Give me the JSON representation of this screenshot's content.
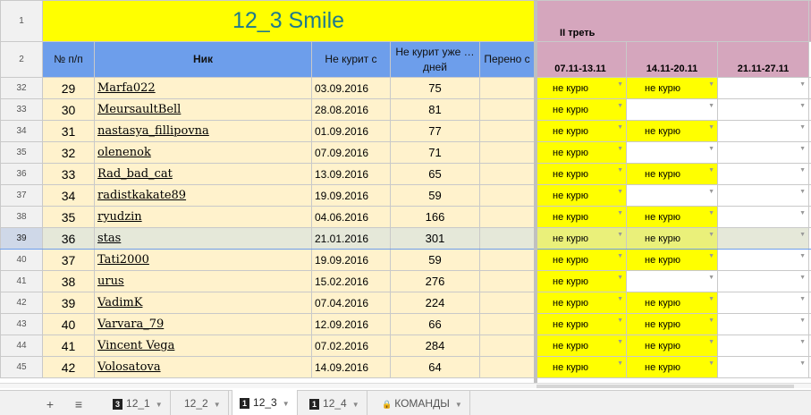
{
  "title": "12_3 Smile",
  "third_label": "II треть",
  "headers": {
    "row1_num": "1",
    "row2_num": "2",
    "no": "№ п/п",
    "nick": "Ник",
    "since": "Не курит с",
    "days": "Не курит уже … дней",
    "moved": "Перено с",
    "week1": "07.11-13.11",
    "week2": "14.11-20.11",
    "week3": "21.11-27.11"
  },
  "rows": [
    {
      "rn": "32",
      "no": "29",
      "nick": "Marfa022",
      "since": "03.09.2016",
      "days": "75",
      "w1": "не курю",
      "w2": "не курю",
      "w3": ""
    },
    {
      "rn": "33",
      "no": "30",
      "nick": "MeursaultBell",
      "since": "28.08.2016",
      "days": "81",
      "w1": "не курю",
      "w2": "",
      "w3": ""
    },
    {
      "rn": "34",
      "no": "31",
      "nick": "nastasya_fillipovna",
      "since": "01.09.2016",
      "days": "77",
      "w1": "не курю",
      "w2": "не курю",
      "w3": ""
    },
    {
      "rn": "35",
      "no": "32",
      "nick": "olenenok",
      "since": "07.09.2016",
      "days": "71",
      "w1": "не курю",
      "w2": "",
      "w3": ""
    },
    {
      "rn": "36",
      "no": "33",
      "nick": "Rad_bad_cat",
      "since": "13.09.2016",
      "days": "65",
      "w1": "не курю",
      "w2": "не курю",
      "w3": ""
    },
    {
      "rn": "37",
      "no": "34",
      "nick": "radistkakate89",
      "since": "19.09.2016",
      "days": "59",
      "w1": "не курю",
      "w2": "",
      "w3": ""
    },
    {
      "rn": "38",
      "no": "35",
      "nick": "ryudzin",
      "since": "04.06.2016",
      "days": "166",
      "w1": "не курю",
      "w2": "не курю",
      "w3": ""
    },
    {
      "rn": "39",
      "no": "36",
      "nick": "stas",
      "since": "21.01.2016",
      "days": "301",
      "w1": "не курю",
      "w2": "не курю",
      "w3": ""
    },
    {
      "rn": "40",
      "no": "37",
      "nick": "Tati2000",
      "since": "19.09.2016",
      "days": "59",
      "w1": "не курю",
      "w2": "не курю",
      "w3": ""
    },
    {
      "rn": "41",
      "no": "38",
      "nick": "urus",
      "since": "15.02.2016",
      "days": "276",
      "w1": "не курю",
      "w2": "",
      "w3": ""
    },
    {
      "rn": "42",
      "no": "39",
      "nick": "VadimK",
      "since": "07.04.2016",
      "days": "224",
      "w1": "не курю",
      "w2": "не курю",
      "w3": ""
    },
    {
      "rn": "43",
      "no": "40",
      "nick": "Varvara_79",
      "since": "12.09.2016",
      "days": "66",
      "w1": "не курю",
      "w2": "не курю",
      "w3": ""
    },
    {
      "rn": "44",
      "no": "41",
      "nick": "Vincent Vega",
      "since": "07.02.2016",
      "days": "284",
      "w1": "не курю",
      "w2": "не курю",
      "w3": ""
    },
    {
      "rn": "45",
      "no": "42",
      "nick": "Volosatova",
      "since": "14.09.2016",
      "days": "64",
      "w1": "не курю",
      "w2": "не курю",
      "w3": ""
    }
  ],
  "selected_row": "39",
  "tabs": [
    {
      "label": "12_1",
      "badge": "3"
    },
    {
      "label": "12_2",
      "badge": ""
    },
    {
      "label": "12_3",
      "badge": "1"
    },
    {
      "label": "12_4",
      "badge": "1"
    },
    {
      "label": "КОМАНДЫ",
      "badge": ""
    }
  ],
  "active_tab": "12_3",
  "tab_controls": {
    "add": "+",
    "menu": "≡"
  },
  "colors": {
    "title_bg": "#ffff00",
    "title_fg": "#1f7a8c",
    "header_blue": "#6d9eeb",
    "header_pink": "#d5a6bd",
    "data_bg": "#fff2cc",
    "status_yes": "#ffff00"
  }
}
